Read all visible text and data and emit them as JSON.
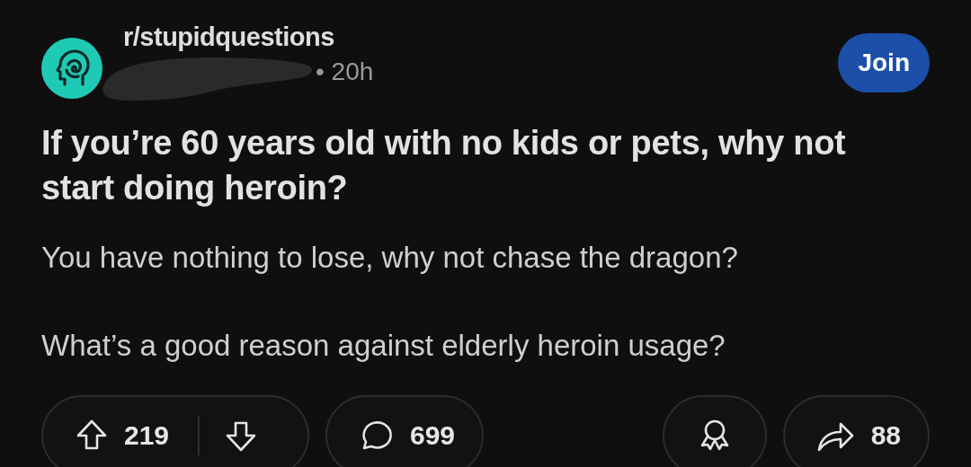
{
  "post": {
    "subreddit": "r/stupidquestions",
    "author_redacted": true,
    "time": "• 20h",
    "join_label": "Join",
    "title": "If you’re 60 years old with no kids or pets, why not start doing heroin?",
    "body": [
      "You have nothing to lose, why not chase the dragon?",
      "What’s a good reason against elderly heroin usage?"
    ]
  },
  "actions": {
    "votes": "219",
    "comments": "699",
    "shares": "88"
  }
}
